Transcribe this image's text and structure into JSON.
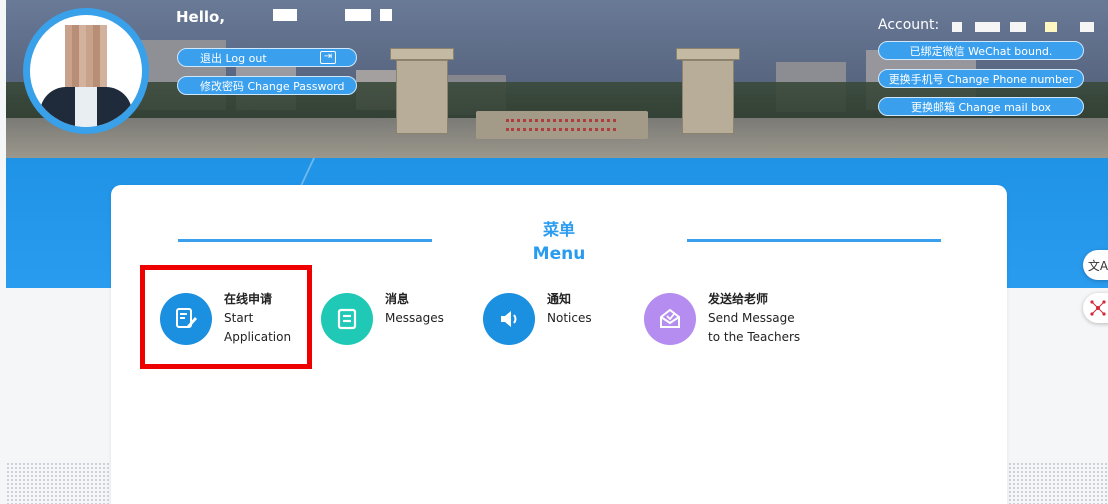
{
  "header": {
    "greeting": "Hello,",
    "logout_label": "退出 Log out",
    "change_password_label": "修改密码 Change Password",
    "account_label": "Account:",
    "wechat_label": "已绑定微信 WeChat bound.",
    "change_phone_label": "更换手机号 Change Phone number",
    "change_mail_label": "更换邮箱 Change mail box"
  },
  "menu": {
    "title_cn": "菜单",
    "title_en": "Menu",
    "items": [
      {
        "cn": "在线申请",
        "en1": "Start",
        "en2": "Application",
        "icon": "edit-document-icon",
        "color": "#1b8fe0"
      },
      {
        "cn": "消息",
        "en1": "Messages",
        "en2": "",
        "icon": "message-icon",
        "color": "#1fc9b5"
      },
      {
        "cn": "通知",
        "en1": "Notices",
        "en2": "",
        "icon": "speaker-icon",
        "color": "#1b8fe0"
      },
      {
        "cn": "发送给老师",
        "en1": "Send Message",
        "en2": "to the Teachers",
        "icon": "envelope-icon",
        "color": "#b58cf0"
      }
    ]
  },
  "floating": {
    "translate_glyph": "文A"
  },
  "colors": {
    "primary": "#2a9cf0",
    "highlight": "#ee0000"
  }
}
